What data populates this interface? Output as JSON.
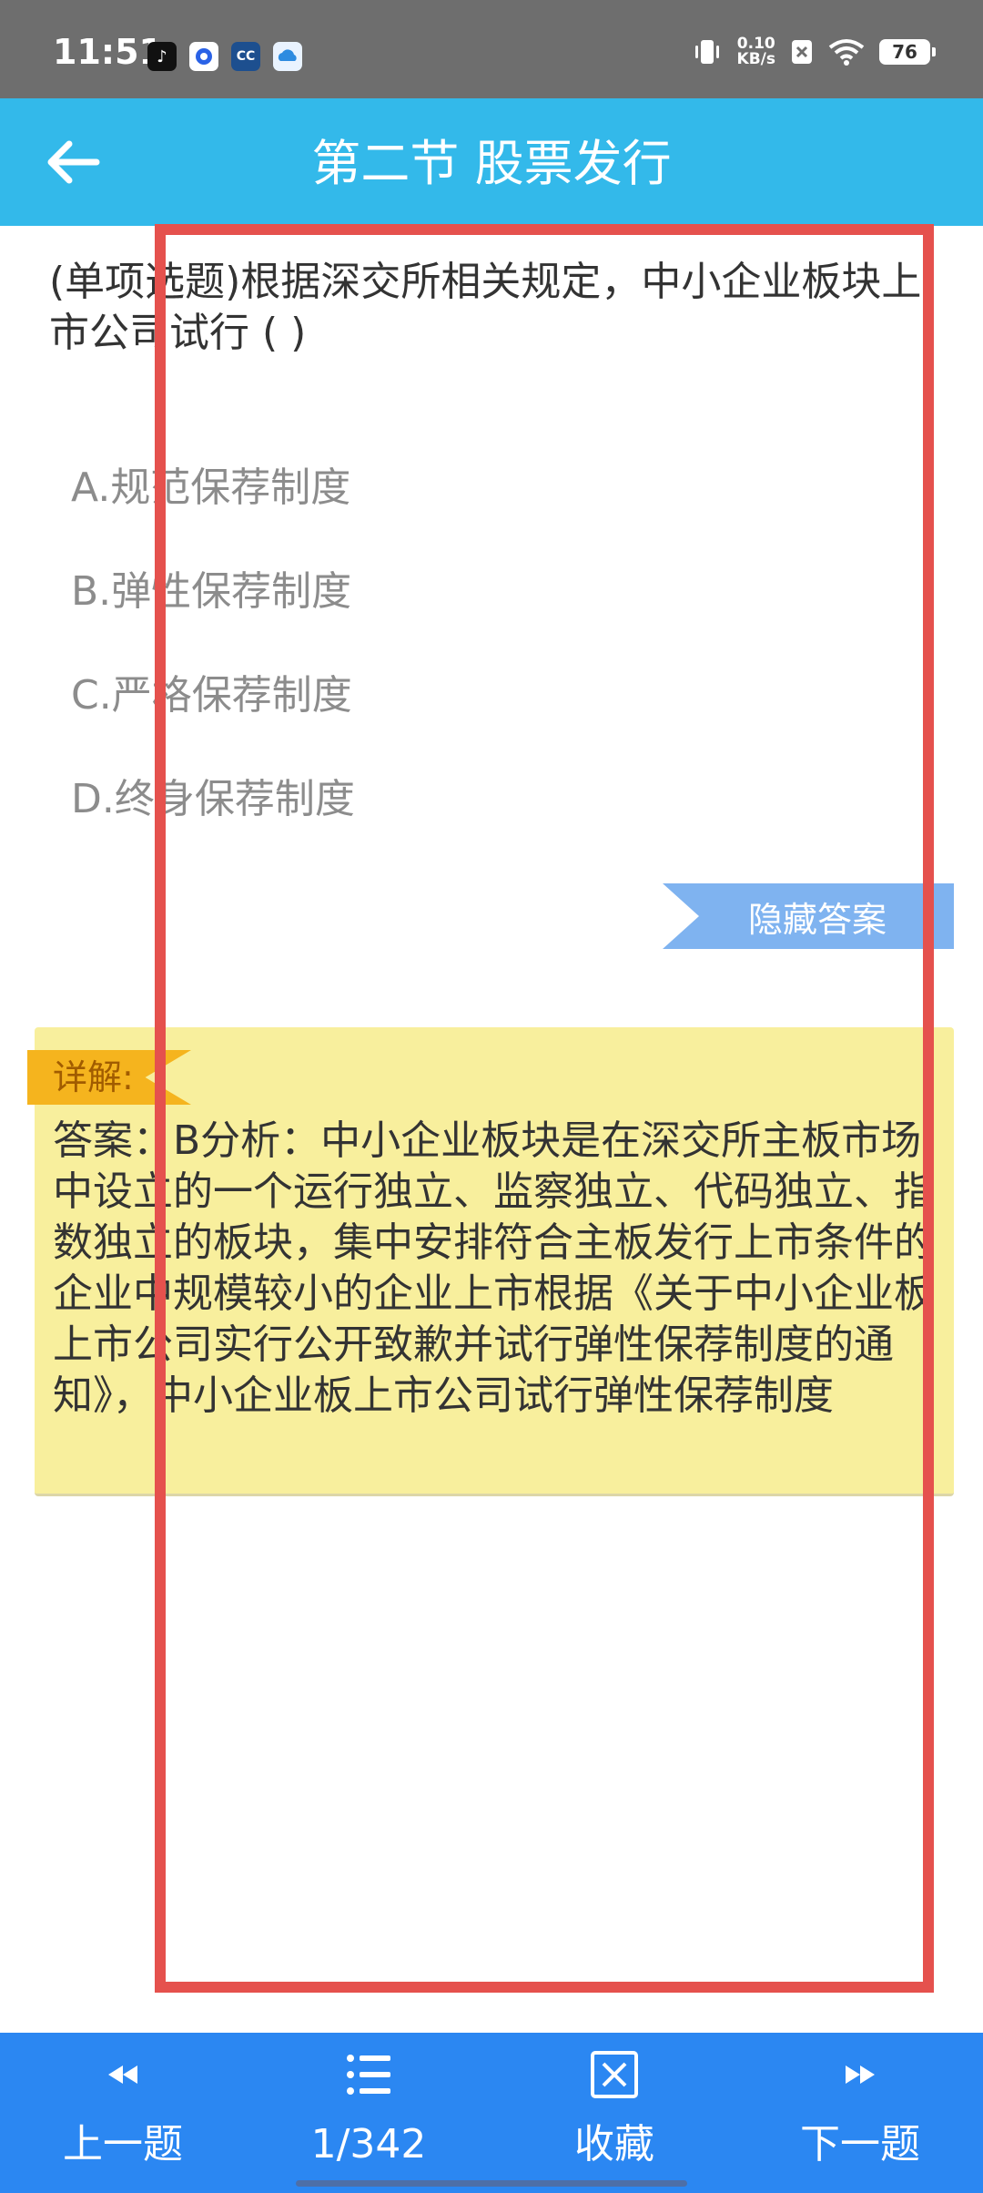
{
  "status_bar": {
    "time": "11:51",
    "net_speed_value": "0.10",
    "net_speed_unit": "KB/s",
    "battery": "76",
    "app_icons": [
      "tiktok-icon",
      "browser-icon",
      "exam-app-icon",
      "cloud-app-icon"
    ],
    "system_icons": [
      "vibrate-icon",
      "no-sim-icon",
      "wifi-icon",
      "battery-icon"
    ]
  },
  "header": {
    "title": "第二节 股票发行",
    "back_icon": "back-arrow-icon",
    "background": "#33b9ea"
  },
  "question": {
    "text": "(单项选题)根据深交所相关规定，中小企业板块上市公司试行 ( )",
    "options": [
      "A.规范保荐制度",
      "B.弹性保荐制度",
      "C.严格保荐制度",
      "D.终身保荐制度"
    ]
  },
  "hide_answer_button": {
    "label": "隐藏答案",
    "color": "#7fb3f0"
  },
  "explanation": {
    "tag": "详解:",
    "text": "答案：B分析：中小企业板块是在深交所主板市场中设立的一个运行独立、监察独立、代码独立、指数独立的板块，集中安排符合主板发行上市条件的企业中规模较小的企业上市根据《关于中小企业板上市公司实行公开致歉并试行弹性保荐制度的通知》，中小企业板上市公司试行弹性保荐制度",
    "background": "#f8ef9d",
    "tag_color": "#f5b41e"
  },
  "annotation": {
    "highlight_color": "#e5514d"
  },
  "bottom_nav": {
    "background": "#2b87f2",
    "items": [
      {
        "label": "上一题",
        "icon": "previous-icon"
      },
      {
        "label": "1/342",
        "icon": "list-icon"
      },
      {
        "label": "收藏",
        "icon": "favorite-box-icon"
      },
      {
        "label": "下一题",
        "icon": "next-icon"
      }
    ]
  }
}
